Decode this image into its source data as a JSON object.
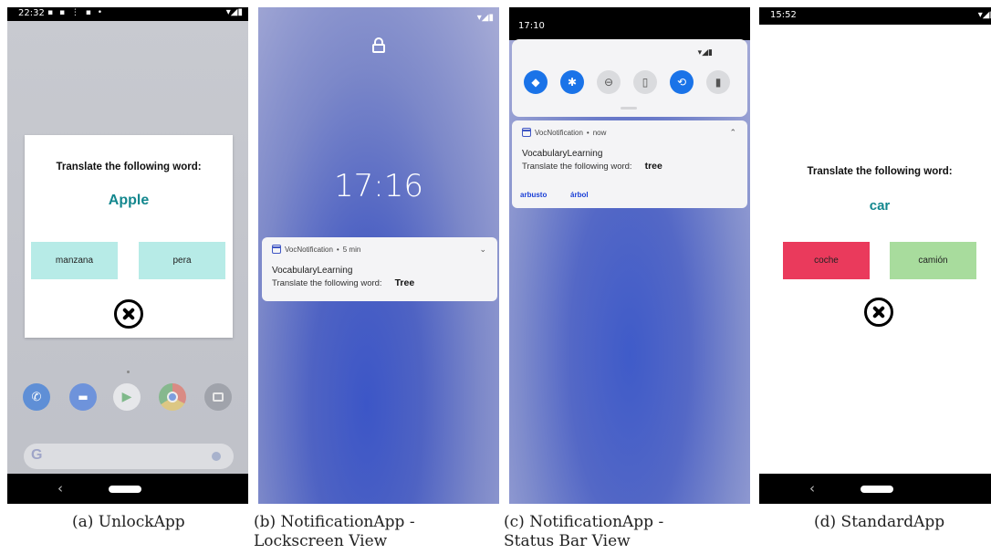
{
  "phones": {
    "unlock": {
      "status_time": "22:32",
      "prompt": "Translate the following word:",
      "word": "Apple",
      "options": [
        "manzana",
        "pera"
      ]
    },
    "lockscreen": {
      "clock": "17:16",
      "notification": {
        "app": "VocNotification",
        "separator": "•",
        "time": "5 min",
        "title": "VocabularyLearning",
        "body": "Translate the following word:",
        "word": "Tree"
      }
    },
    "statusbar": {
      "status_time": "17:10",
      "notification": {
        "app": "VocNotification",
        "separator": "•",
        "time": "now",
        "title": "VocabularyLearning",
        "body": "Translate the following word:",
        "word": "tree",
        "actions": [
          "arbusto",
          "árbol"
        ]
      }
    },
    "standard": {
      "status_time": "15:52",
      "prompt": "Translate the following word:",
      "word": "car",
      "options": [
        "coche",
        "camión"
      ]
    }
  },
  "captions": [
    "(a) UnlockApp",
    "(b) NotificationApp -",
    "Lockscreen View",
    "(c) NotificationApp -",
    "Status Bar View",
    "(d) StandardApp"
  ],
  "colors": {
    "teal_word": "#13878e",
    "option_teal": "#b7ebe7",
    "option_red": "#ea3a5c",
    "option_green": "#a8dc9d",
    "qs_blue": "#1a73e8",
    "action_blue": "#1a3fd6"
  }
}
